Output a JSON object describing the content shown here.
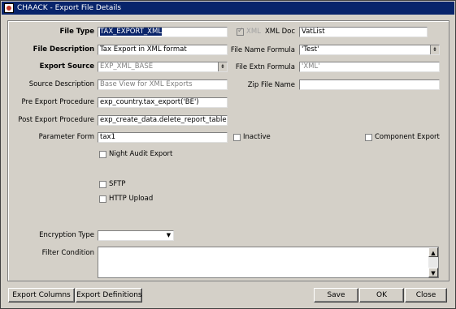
{
  "window": {
    "title": "CHAACK - Export File Details"
  },
  "fields": {
    "file_type": {
      "label": "File Type",
      "value": "TAX_EXPORT_XML"
    },
    "file_description": {
      "label": "File Description",
      "value": "Tax Export in XML format"
    },
    "export_source": {
      "label": "Export Source",
      "value": "EXP_XML_BASE"
    },
    "source_description": {
      "label": "Source Description",
      "value": "Base View for XML Exports"
    },
    "pre_export_procedure": {
      "label": "Pre Export Procedure",
      "value": "exp_country.tax_export('BE')"
    },
    "post_export_procedure": {
      "label": "Post Export Procedure",
      "value": "exp_create_data.delete_report_table"
    },
    "parameter_form": {
      "label": "Parameter Form",
      "value": "tax1"
    },
    "xml_checkbox_label": "XML",
    "xml_doc": {
      "label": "XML Doc",
      "value": "VatList"
    },
    "file_name_formula": {
      "label": "File Name Formula",
      "value": "'Test'"
    },
    "file_extn_formula": {
      "label": "File Extn Formula",
      "value": "'XML'"
    },
    "zip_file_name": {
      "label": "Zip File Name",
      "value": ""
    },
    "encryption_type": {
      "label": "Encryption Type",
      "value": ""
    },
    "filter_condition": {
      "label": "Filter Condition",
      "value": ""
    }
  },
  "checkboxes": {
    "inactive": {
      "label": "Inactive",
      "checked": false
    },
    "component_export": {
      "label": "Component Export",
      "checked": false
    },
    "night_audit_export": {
      "label": "Night Audit Export",
      "checked": false
    },
    "sftp": {
      "label": "SFTP",
      "checked": false
    },
    "http_upload": {
      "label": "HTTP Upload",
      "checked": false
    },
    "xml": {
      "checked": true
    }
  },
  "buttons": {
    "export_columns": "Export Columns",
    "export_definitions": "Export Definitions",
    "save": "Save",
    "ok": "OK",
    "close": "Close"
  },
  "icons": {
    "dropdown": "chevron-down-icon",
    "scroll_up": "arrow-up-icon",
    "scroll_down": "arrow-down-icon"
  },
  "colors": {
    "titlebar": "#08246b",
    "selection": "#0a246a",
    "window_bg": "#d4d0c8"
  }
}
